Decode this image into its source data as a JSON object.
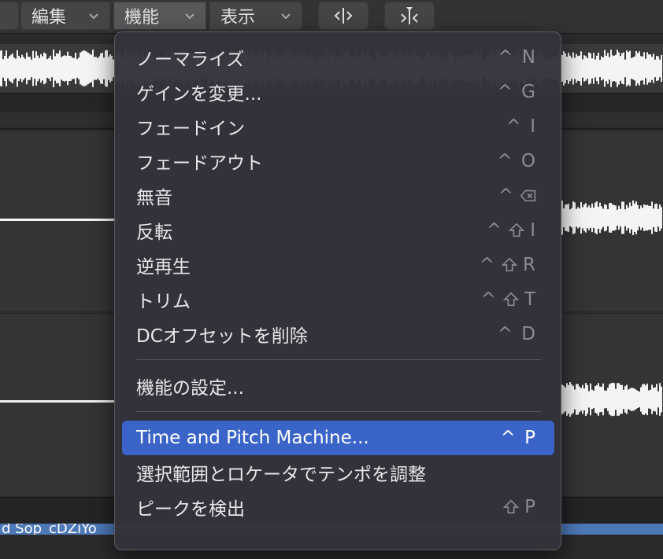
{
  "toolbar": {
    "edit_menu": "編集",
    "function_menu": "機能",
    "view_menu": "表示",
    "icons": [
      "chevron-down-icon",
      "split-horizontal-icon",
      "marker-split-icon"
    ]
  },
  "region_title": "d Sop_cDZiYo",
  "menu": {
    "items": [
      {
        "label": "ノーマライズ",
        "shortcut": "^ N"
      },
      {
        "label": "ゲインを変更...",
        "shortcut": "^ G"
      },
      {
        "label": "フェードイン",
        "shortcut": "^ I"
      },
      {
        "label": "フェードアウト",
        "shortcut": "^ O"
      },
      {
        "label": "無音",
        "shortcut": "^"
      },
      {
        "label": "反転",
        "shortcut": "^ I"
      },
      {
        "label": "逆再生",
        "shortcut": "^ R"
      },
      {
        "label": "トリム",
        "shortcut": "^ T"
      },
      {
        "label": "DCオフセットを削除",
        "shortcut": "^ D"
      },
      {
        "label": "機能の設定..."
      },
      {
        "label": "Time and Pitch Machine...",
        "shortcut": "^ P"
      },
      {
        "label": "選択範囲とロケータでテンポを調整"
      },
      {
        "label": "ピークを検出",
        "shortcut": "P"
      }
    ]
  },
  "colors": {
    "highlight": "#3a64c8",
    "menu_bg": "#34323a",
    "region_blue": "#4d79b8"
  }
}
